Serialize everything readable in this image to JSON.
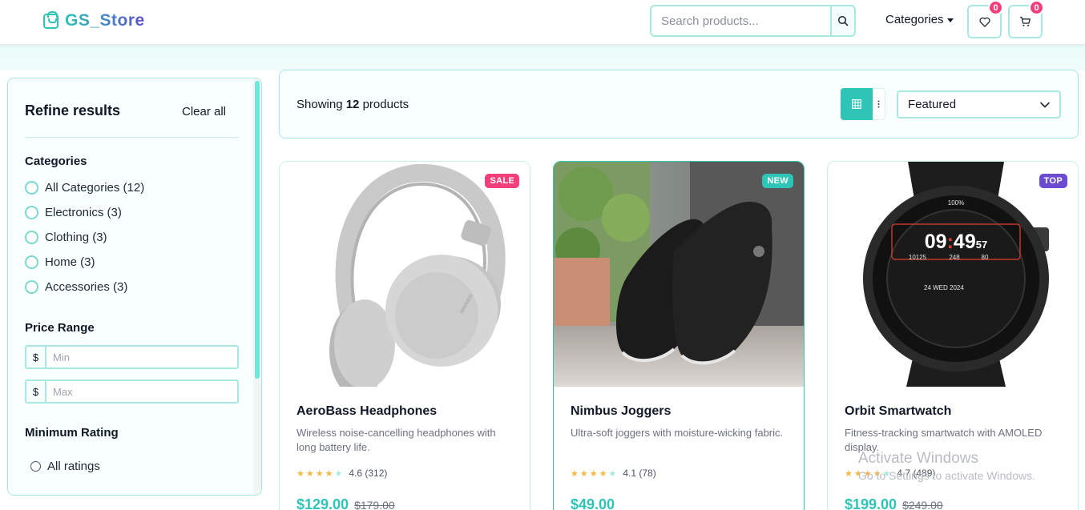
{
  "header": {
    "logo_text": "GS_Store",
    "search_placeholder": "Search products...",
    "categories_label": "Categories",
    "wishlist_count": "0",
    "cart_count": "0"
  },
  "sidebar": {
    "title": "Refine results",
    "clear_all": "Clear all",
    "categories_title": "Categories",
    "categories": [
      {
        "label": "All Categories (12)"
      },
      {
        "label": "Electronics (3)"
      },
      {
        "label": "Clothing (3)"
      },
      {
        "label": "Home (3)"
      },
      {
        "label": "Accessories (3)"
      }
    ],
    "price_title": "Price Range",
    "currency": "$",
    "min_placeholder": "Min",
    "max_placeholder": "Max",
    "rating_title": "Minimum Rating",
    "rating_option": "All ratings"
  },
  "toolbar": {
    "showing_prefix": "Showing",
    "count": "12",
    "showing_suffix": "products",
    "sort_value": "Featured"
  },
  "products": [
    {
      "tag": "SALE",
      "tag_color": "#f43f7a",
      "title": "AeroBass Headphones",
      "description": "Wireless noise-cancelling headphones with long battery life.",
      "rating": 4.6,
      "rating_text": "4.6 (312)",
      "price": "$129.00",
      "old_price": "$179.00"
    },
    {
      "tag": "NEW",
      "tag_color": "#2ec4b6",
      "title": "Nimbus Joggers",
      "description": "Ultra-soft joggers with moisture-wicking fabric.",
      "rating": 4.1,
      "rating_text": "4.1 (78)",
      "price": "$49.00",
      "old_price": ""
    },
    {
      "tag": "TOP",
      "tag_color": "#6d4bd1",
      "title": "Orbit Smartwatch",
      "description": "Fitness-tracking smartwatch with AMOLED display.",
      "rating": 4.7,
      "rating_text": "4.7 (489)",
      "price": "$199.00",
      "old_price": "$249.00",
      "watch": {
        "battery": "100%",
        "hour": "09",
        "minute": "49",
        "seconds": "57",
        "steps": "10125",
        "calories": "248",
        "heart": "80",
        "date": "24 WED 2024"
      }
    }
  ],
  "watermark": {
    "title": "Activate Windows",
    "subtitle": "Go to Settings to activate Windows."
  }
}
